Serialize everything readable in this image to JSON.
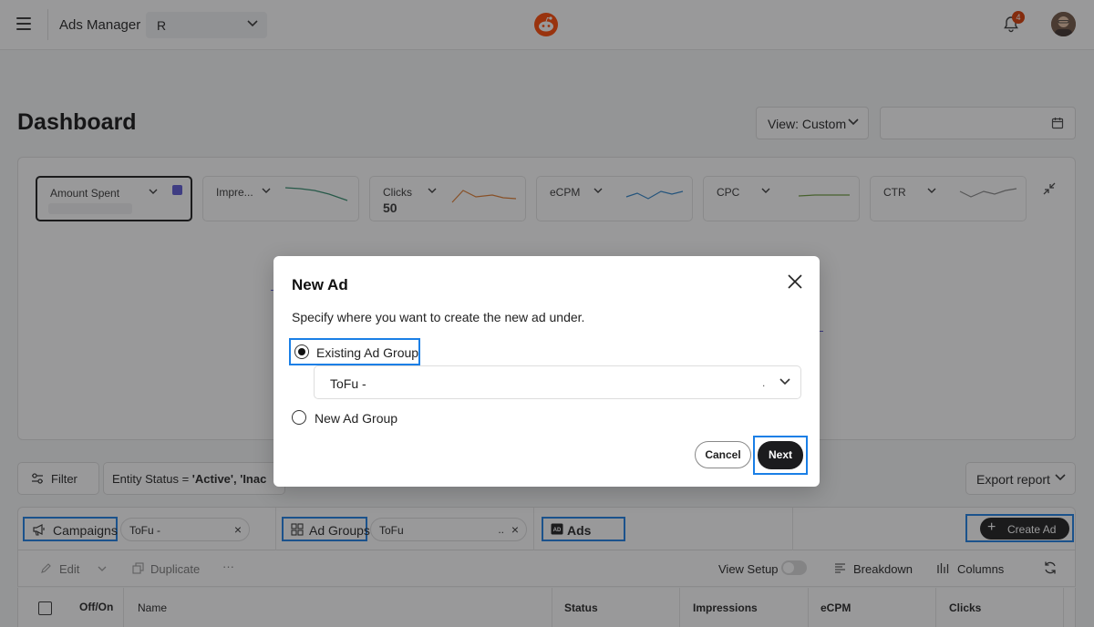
{
  "topbar": {
    "app_title": "Ads Manager",
    "account_value": "R",
    "notification_count": "4"
  },
  "dashboard": {
    "title": "Dashboard",
    "view_select": "View: Custom"
  },
  "metrics": [
    {
      "label": "Amount Spent",
      "value": "",
      "color": "#5b58d6"
    },
    {
      "label": "Impre...",
      "value": "",
      "color": "#2f8a6b"
    },
    {
      "label": "Clicks",
      "value": "50",
      "color": "#e07b2e"
    },
    {
      "label": "eCPM",
      "value": "",
      "color": "#2b82c9"
    },
    {
      "label": "CPC",
      "value": "",
      "color": "#6a9a3a"
    },
    {
      "label": "CTR",
      "value": "",
      "color": "#888888"
    }
  ],
  "filters": {
    "filter_label": "Filter",
    "entity_status_key": "Entity Status = ",
    "entity_status_value": "'Active', 'Inac",
    "export_label": "Export report"
  },
  "entity_bar": {
    "campaigns_label": "Campaigns",
    "campaign_chip": "ToFu -",
    "ad_groups_label": "Ad Groups",
    "ad_group_chip": "ToFu",
    "ad_group_chip_ellipsis": "..",
    "ads_label": "Ads",
    "create_ad_label": "Create Ad"
  },
  "toolbar": {
    "edit": "Edit",
    "duplicate": "Duplicate",
    "more": "···",
    "view_setup": "View Setup",
    "breakdown": "Breakdown",
    "columns": "Columns"
  },
  "table": {
    "headers": [
      "Off/On",
      "Name",
      "Status",
      "Impressions",
      "eCPM",
      "Clicks"
    ]
  },
  "modal": {
    "title": "New Ad",
    "description": "Specify where you want to create the new ad under.",
    "option_existing": "Existing Ad Group",
    "option_new": "New Ad Group",
    "selected_group": "ToFu -",
    "selected_group_trail": ".",
    "cancel_label": "Cancel",
    "next_label": "Next"
  },
  "colors": {
    "highlight": "#1a7fe6",
    "brand": "#ff4500",
    "accent_dark": "#1c1c1e"
  }
}
